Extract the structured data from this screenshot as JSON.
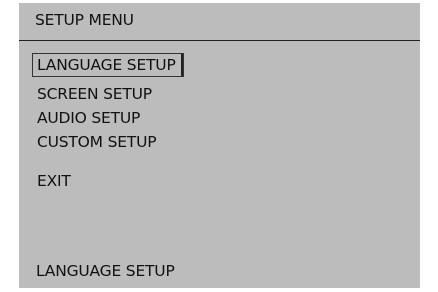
{
  "header": {
    "title": "SETUP MENU"
  },
  "menu": {
    "items": [
      {
        "label": "LANGUAGE SETUP",
        "selected": true
      },
      {
        "label": "SCREEN SETUP",
        "selected": false
      },
      {
        "label": "AUDIO SETUP",
        "selected": false
      },
      {
        "label": "CUSTOM SETUP",
        "selected": false
      },
      {
        "label": "EXIT",
        "selected": false
      }
    ]
  },
  "footer": {
    "status_text": "LANGUAGE SETUP"
  },
  "colors": {
    "screen_background": "#bcbcbc",
    "text": "#111111",
    "rule": "#222222"
  }
}
